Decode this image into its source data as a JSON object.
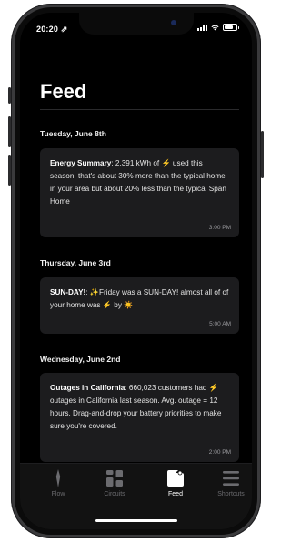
{
  "status": {
    "time": "20:20 ⇗"
  },
  "page": {
    "title": "Feed"
  },
  "feed": [
    {
      "date": "Tuesday, June 8th",
      "heading": "Energy Summary",
      "text_a": ": 2,391 kWh of ",
      "emoji_a": "⚡",
      "text_b": " used this season, that's about 30% more than the typical home in your area but about 20% less than the typical Span Home",
      "emoji_b": "",
      "text_c": "",
      "time": "3:00 PM"
    },
    {
      "date": "Thursday, June 3rd",
      "heading": "SUN-DAY!",
      "text_a": ": ✨Friday was a SUN-DAY! almost all of of your home was ",
      "emoji_a": "⚡",
      "text_b": " by ",
      "emoji_b": "☀️",
      "text_c": "",
      "time": "5:00 AM"
    },
    {
      "date": "Wednesday, June 2nd",
      "heading": "Outages in California",
      "text_a": ": 660,023 customers had ",
      "emoji_a": "⚡",
      "text_b": " outages in California last season. Avg. outage = 12 hours. Drag-and-drop your battery priorities to make sure you're covered.",
      "emoji_b": "",
      "text_c": "",
      "time": "2:00 PM"
    }
  ],
  "tabs": [
    {
      "label": "Flow",
      "icon": "flow-icon",
      "active": false
    },
    {
      "label": "Circuits",
      "icon": "circuits-icon",
      "active": false
    },
    {
      "label": "Feed",
      "icon": "feed-icon",
      "active": true
    },
    {
      "label": "Shortcuts",
      "icon": "shortcuts-icon",
      "active": false
    }
  ],
  "colors": {
    "accent_active": "#ffffff",
    "inactive": "#6b6b6f",
    "card": "#1c1c1e",
    "background": "#000000"
  }
}
